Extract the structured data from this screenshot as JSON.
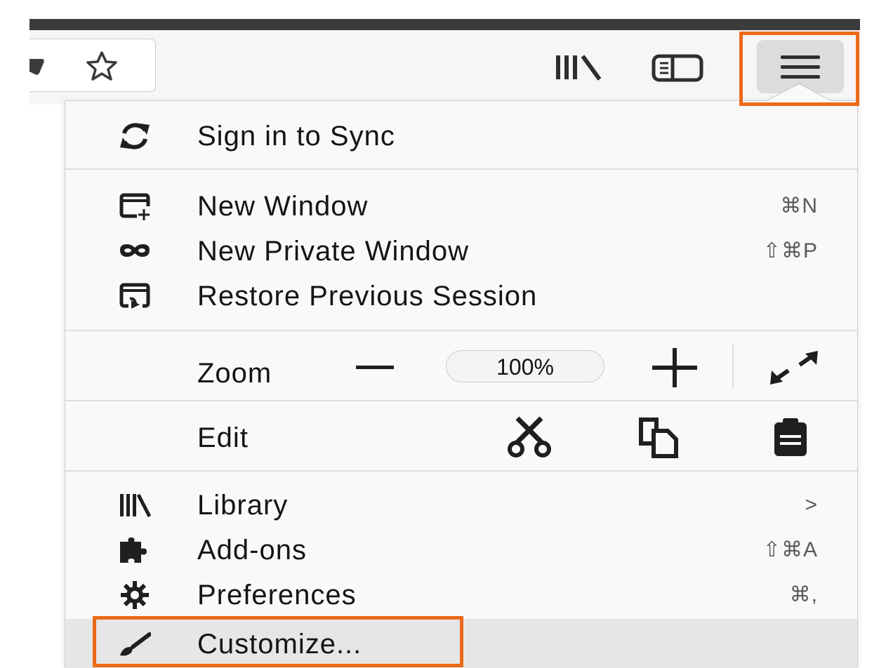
{
  "menu": {
    "sync_label": "Sign in to Sync",
    "new_window_label": "New Window",
    "new_window_shortcut": "⌘N",
    "new_private_window_label": "New Private Window",
    "new_private_window_shortcut": "⇧⌘P",
    "restore_session_label": "Restore Previous Session",
    "zoom_label": "Zoom",
    "zoom_value": "100%",
    "edit_label": "Edit",
    "library_label": "Library",
    "library_chevron": ">",
    "addons_label": "Add-ons",
    "addons_shortcut": "⇧⌘A",
    "preferences_label": "Preferences",
    "preferences_shortcut": "⌘,",
    "customize_label": "Customize..."
  },
  "colors": {
    "highlight": "#ec6a19",
    "panel_bg": "#f9f9f9",
    "hover_bg": "#e6e6e6",
    "topbar": "#3b3b3b"
  },
  "icons": {
    "toolbar": [
      "star-icon",
      "library-icon",
      "sidebar-icon",
      "hamburger-menu-icon"
    ],
    "menu": [
      "sync-icon",
      "new-window-icon",
      "private-mask-icon",
      "restore-session-icon",
      "zoom-out-icon",
      "zoom-in-icon",
      "fullscreen-icon",
      "cut-icon",
      "copy-icon",
      "paste-icon",
      "library-icon",
      "addons-puzzle-icon",
      "preferences-gear-icon",
      "customize-brush-icon"
    ]
  }
}
